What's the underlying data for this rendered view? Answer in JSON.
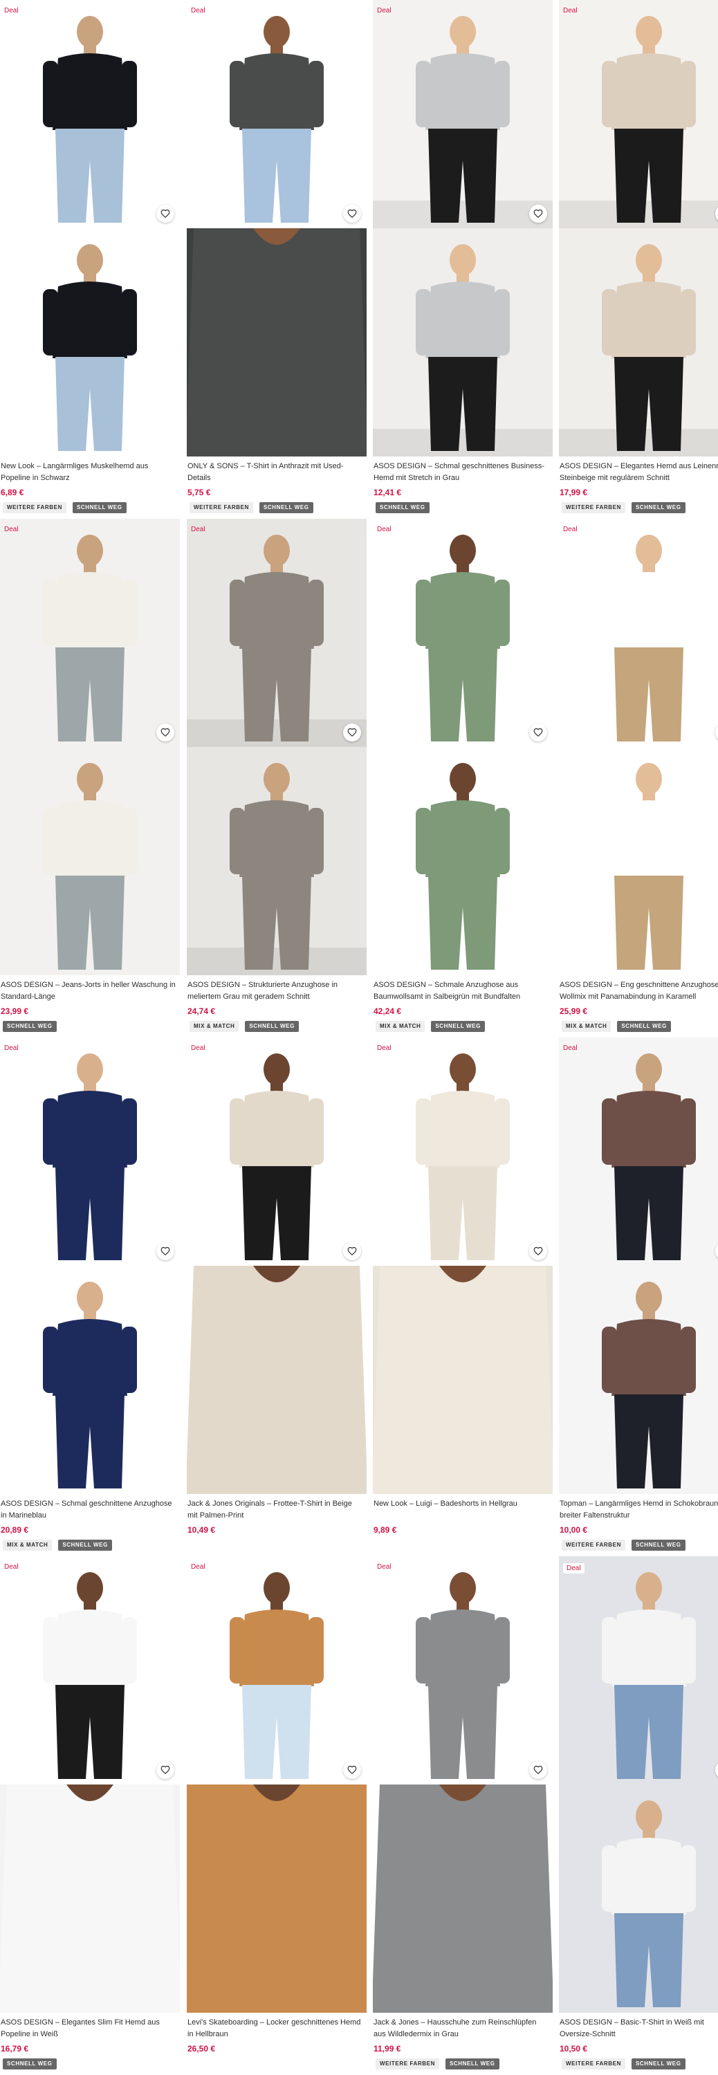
{
  "deal_label": "Deal",
  "colors": {
    "accent": "#d01345",
    "tag_dark": "#666666",
    "tag_light": "#eeeeee"
  },
  "products": [
    {
      "title": "New Look – Langärmliges Muskelhemd aus Popeline in Schwarz",
      "price": "6,89 €",
      "tags": [
        {
          "label": "Weitere Farben",
          "style": "light"
        },
        {
          "label": "Schnell weg",
          "style": "dark"
        }
      ],
      "bg_a": "#ffffff",
      "bg_b": "#ffffff",
      "top_color": "#15171c",
      "bottom_color": "#a8c0d8",
      "skin": "#c9a27e",
      "crop_b": false,
      "floor": false,
      "boxed_deal": false
    },
    {
      "title": "ONLY & SONS – T-Shirt in Anthrazit mit Used-Details",
      "price": "5,75 €",
      "tags": [
        {
          "label": "Weitere Farben",
          "style": "light"
        },
        {
          "label": "Schnell weg",
          "style": "dark"
        }
      ],
      "bg_a": "#ffffff",
      "bg_b": "#3e4040",
      "top_color": "#4a4c4b",
      "bottom_color": "#a9c2dd",
      "skin": "#8a5a3c",
      "crop_b": true,
      "floor": false,
      "boxed_deal": false
    },
    {
      "title": "ASOS DESIGN – Schmal geschnittenes Business-Hemd mit Stretch in Grau",
      "price": "12,41 €",
      "tags": [
        {
          "label": "Schnell weg",
          "style": "dark"
        }
      ],
      "bg_a": "#f3f2f0",
      "bg_b": "#efeeec",
      "top_color": "#c7c8c9",
      "bottom_color": "#1c1c1c",
      "skin": "#e3bc98",
      "crop_b": false,
      "floor": true,
      "boxed_deal": false
    },
    {
      "title": "ASOS DESIGN – Elegantes Hemd aus Leinenmix in Steinbeige mit regulärem Schnitt",
      "price": "17,99 €",
      "tags": [
        {
          "label": "Weitere Farben",
          "style": "light"
        },
        {
          "label": "Schnell weg",
          "style": "dark"
        }
      ],
      "bg_a": "#f4f2ef",
      "bg_b": "#f0eeeb",
      "top_color": "#dccfbe",
      "bottom_color": "#1b1b1b",
      "skin": "#e3bc98",
      "crop_b": false,
      "floor": true,
      "boxed_deal": false
    },
    {
      "title": "ASOS DESIGN – Jeans-Jorts in heller Waschung in Standard-Länge",
      "price": "23,99 €",
      "tags": [
        {
          "label": "Schnell weg",
          "style": "dark"
        }
      ],
      "bg_a": "#f2f1ef",
      "bg_b": "#f2f1ef",
      "top_color": "#f1efe8",
      "bottom_color": "#9da6a8",
      "skin": "#c9a27e",
      "crop_b": false,
      "floor": false,
      "boxed_deal": false
    },
    {
      "title": "ASOS DESIGN – Strukturierte Anzughose in meliertem Grau mit geradem Schnitt",
      "price": "24,74 €",
      "tags": [
        {
          "label": "Mix & Match",
          "style": "light"
        },
        {
          "label": "Schnell weg",
          "style": "dark"
        }
      ],
      "bg_a": "#e8e6e3",
      "bg_b": "#e8e6e3",
      "top_color": "#8c867e",
      "bottom_color": "#8c867e",
      "skin": "#c9a27e",
      "crop_b": false,
      "floor": true,
      "boxed_deal": false
    },
    {
      "title": "ASOS DESIGN – Schmale Anzughose aus Baumwollsamt in Salbeigrün mit Bundfalten",
      "price": "42,24 €",
      "tags": [
        {
          "label": "Mix & Match",
          "style": "light"
        },
        {
          "label": "Schnell weg",
          "style": "dark"
        }
      ],
      "bg_a": "#ffffff",
      "bg_b": "#ffffff",
      "top_color": "#7e9a79",
      "bottom_color": "#7e9a79",
      "skin": "#6b4530",
      "crop_b": false,
      "floor": false,
      "boxed_deal": false
    },
    {
      "title": "ASOS DESIGN – Eng geschnittene Anzughose aus Wollmix mit Panamabindung in Karamell",
      "price": "25,99 €",
      "tags": [
        {
          "label": "Mix & Match",
          "style": "light"
        },
        {
          "label": "Schnell weg",
          "style": "dark"
        }
      ],
      "bg_a": "#ffffff",
      "bg_b": "#ffffff",
      "top_color": "#ffffff",
      "bottom_color": "#c4a57c",
      "skin": "#e3bc98",
      "crop_b": false,
      "floor": false,
      "boxed_deal": false
    },
    {
      "title": "ASOS DESIGN – Schmal geschnittene Anzughose in Marineblau",
      "price": "20,89 €",
      "tags": [
        {
          "label": "Mix & Match",
          "style": "light"
        },
        {
          "label": "Schnell weg",
          "style": "dark"
        }
      ],
      "bg_a": "#ffffff",
      "bg_b": "#ffffff",
      "top_color": "#1d2b5c",
      "bottom_color": "#1d2b5c",
      "skin": "#d9b08c",
      "crop_b": false,
      "floor": false,
      "boxed_deal": false
    },
    {
      "title": "Jack & Jones Originals – Frottee-T-Shirt in Beige mit Palmen-Print",
      "price": "10,49 €",
      "tags": [],
      "bg_a": "#ffffff",
      "bg_b": "#ffffff",
      "top_color": "#e2d9ca",
      "bottom_color": "#1b1b1b",
      "skin": "#6b4530",
      "crop_b": true,
      "floor": false,
      "boxed_deal": false
    },
    {
      "title": "New Look – Luigi – Badeshorts in Hellgrau",
      "price": "9,89 €",
      "tags": [],
      "bg_a": "#ffffff",
      "bg_b": "#e9e4d8",
      "top_color": "#efe8dc",
      "bottom_color": "#e6dfd1",
      "skin": "#7a4e34",
      "crop_b": true,
      "floor": false,
      "boxed_deal": false
    },
    {
      "title": "Topman – Langärmliges Hemd in Schokobraun mit breiter Faltenstruktur",
      "price": "10,00 €",
      "tags": [
        {
          "label": "Weitere Farben",
          "style": "light"
        },
        {
          "label": "Schnell weg",
          "style": "dark"
        }
      ],
      "bg_a": "#f5f5f5",
      "bg_b": "#f5f5f5",
      "top_color": "#6e5048",
      "bottom_color": "#1e2129",
      "skin": "#c9a27e",
      "crop_b": false,
      "floor": false,
      "boxed_deal": false
    },
    {
      "title": "ASOS DESIGN – Elegantes Slim Fit Hemd aus Popeline in Weiß",
      "price": "16,79 €",
      "tags": [
        {
          "label": "Schnell weg",
          "style": "dark"
        }
      ],
      "bg_a": "#ffffff",
      "bg_b": "#f3f3f3",
      "top_color": "#f7f7f7",
      "bottom_color": "#1b1b1b",
      "skin": "#6b4530",
      "crop_b": true,
      "floor": false,
      "boxed_deal": false
    },
    {
      "title": "Levi's Skateboarding – Locker geschnittenes Hemd in Hellbraun",
      "price": "26,50 €",
      "tags": [],
      "bg_a": "#ffffff",
      "bg_b": "#c98a4e",
      "top_color": "#c98a4e",
      "bottom_color": "#cfe0ee",
      "skin": "#6b4530",
      "crop_b": true,
      "floor": false,
      "boxed_deal": false
    },
    {
      "title": "Jack & Jones – Hausschuhe zum Reinschlüpfen aus Wildledermix in Grau",
      "price": "11,99 €",
      "tags": [
        {
          "label": "Weitere Farben",
          "style": "light"
        },
        {
          "label": "Schnell weg",
          "style": "dark"
        }
      ],
      "bg_a": "#ffffff",
      "bg_b": "#ffffff",
      "top_color": "#8a8c8e",
      "bottom_color": "#8a8c8e",
      "skin": "#7a4e34",
      "crop_b": true,
      "floor": false,
      "boxed_deal": false
    },
    {
      "title": "ASOS DESIGN – Basic-T-Shirt in Weiß mit Oversize-Schnitt",
      "price": "10,50 €",
      "tags": [
        {
          "label": "Weitere Farben",
          "style": "light"
        },
        {
          "label": "Schnell weg",
          "style": "dark"
        }
      ],
      "bg_a": "#e2e3e8",
      "bg_b": "#e2e3e8",
      "top_color": "#f4f4f4",
      "bottom_color": "#7f9dc0",
      "skin": "#d9b08c",
      "crop_b": false,
      "floor": false,
      "boxed_deal": true
    }
  ]
}
